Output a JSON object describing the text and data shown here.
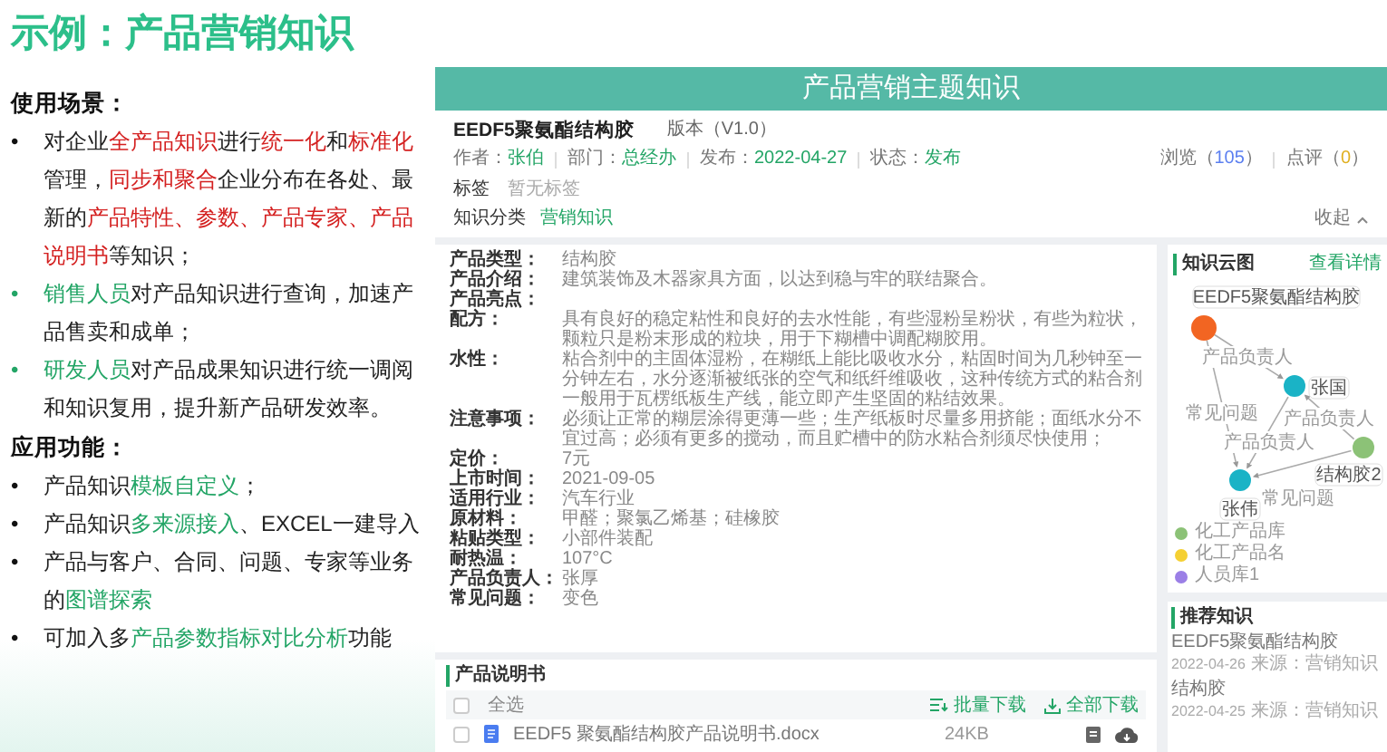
{
  "title": "示例：产品营销知识",
  "sections": [
    {
      "heading": "使用场景：",
      "items": [
        {
          "bullet": "•",
          "accent": false,
          "segments": [
            {
              "text": "对企业",
              "kind": "plain"
            },
            {
              "text": "全产品知识",
              "kind": "red"
            },
            {
              "text": "进行",
              "kind": "plain"
            },
            {
              "text": "统一化",
              "kind": "red"
            },
            {
              "text": "和",
              "kind": "plain"
            },
            {
              "text": "标准化",
              "kind": "red"
            },
            {
              "text": "管理，",
              "kind": "plain"
            },
            {
              "text": "同步和聚合",
              "kind": "red"
            },
            {
              "text": "企业分布在各处、最新的",
              "kind": "plain"
            },
            {
              "text": "产品特性、参数、产品专家、产品说明书",
              "kind": "red"
            },
            {
              "text": "等知识；",
              "kind": "plain"
            }
          ]
        },
        {
          "bullet": "•",
          "accent": true,
          "segments": [
            {
              "text": "销售人员",
              "kind": "green"
            },
            {
              "text": "对产品知识进行查询，加速产品售卖和成单；",
              "kind": "plain"
            }
          ]
        },
        {
          "bullet": "•",
          "accent": true,
          "segments": [
            {
              "text": "研发人员",
              "kind": "green"
            },
            {
              "text": "对产品成果知识进行统一调阅和知识复用，提升新产品研发效率。",
              "kind": "plain"
            }
          ]
        }
      ]
    },
    {
      "heading": "应用功能：",
      "items": [
        {
          "bullet": "•",
          "accent": false,
          "segments": [
            {
              "text": "产品知识",
              "kind": "plain"
            },
            {
              "text": "模板自定义",
              "kind": "green"
            },
            {
              "text": "；",
              "kind": "plain"
            }
          ]
        },
        {
          "bullet": "•",
          "accent": false,
          "segments": [
            {
              "text": "产品知识",
              "kind": "plain"
            },
            {
              "text": "多来源接入",
              "kind": "green"
            },
            {
              "text": "、EXCEL一建导入",
              "kind": "plain"
            }
          ]
        },
        {
          "bullet": "•",
          "accent": false,
          "segments": [
            {
              "text": "产品与客户、合同、问题、专家等业务的",
              "kind": "plain"
            },
            {
              "text": "图谱探索",
              "kind": "green"
            }
          ]
        },
        {
          "bullet": "•",
          "accent": false,
          "segments": [
            {
              "text": "可加入多",
              "kind": "plain"
            },
            {
              "text": "产品参数指标对比分析",
              "kind": "green"
            },
            {
              "text": "功能",
              "kind": "plain"
            }
          ]
        }
      ]
    }
  ],
  "app": {
    "header": "产品营销主题知识",
    "info": {
      "name": "EEDF5聚氨酯结构胶",
      "version": "版本（V1.0）",
      "meta": [
        {
          "label": "作者：",
          "value": "张伯"
        },
        {
          "label": "部门：",
          "value": "总经办"
        },
        {
          "label": "发布：",
          "value": "2022-04-27"
        },
        {
          "label": "状态：",
          "value": "发布"
        }
      ],
      "stats": [
        {
          "label": "浏览（",
          "value": "105",
          "end": "）",
          "kind": "views"
        },
        {
          "label": "点评（",
          "value": "0",
          "end": "）",
          "kind": "comments"
        }
      ],
      "tags_label": "标签",
      "tags_value": "暂无标签",
      "category_label": "知识分类",
      "category_value": "营销知识",
      "collapse": "收起"
    },
    "details": [
      {
        "label": "产品类型：",
        "value": "结构胶"
      },
      {
        "label": "产品介绍：",
        "value": "建筑装饰及木器家具方面，以达到稳与牢的联结聚合。"
      },
      {
        "label": "产品亮点："
      },
      {
        "label": "配方：",
        "value": "具有良好的稳定粘性和良好的去水性能，有些湿粉呈粉状，有些为粒状，颗粒只是粉末形成的粒块，用于下糊槽中调配糊胶用。"
      },
      {
        "label": "水性：",
        "value": "粘合剂中的主固体湿粉，在糊纸上能比吸收水分，粘固时间为几秒钟至一分钟左右，水分逐渐被纸张的空气和纸纤维吸收，这种传统方式的粘合剂一般用于瓦楞纸板生产线，能立即产生坚固的粘结效果。"
      },
      {
        "label": "注意事项：",
        "value": "必须让正常的糊层涂得更薄一些；生产纸板时尽量多用挤能；面纸水分不宜过高；必须有更多的搅动，而且贮槽中的防水粘合剂须尽快使用；"
      },
      {
        "label": "定价：",
        "value": "7元"
      },
      {
        "label": "上市时间：",
        "value": "2021-09-05"
      },
      {
        "label": "适用行业：",
        "value": "汽车行业"
      },
      {
        "label": "原材料：",
        "value": "甲醛；聚氯乙烯基；硅橡胶"
      },
      {
        "label": "粘贴类型：",
        "value": "小部件装配"
      },
      {
        "label": "耐热温：",
        "value": "107°C"
      },
      {
        "label": "产品负责人：",
        "value": "张厚"
      },
      {
        "label": "常见问题：",
        "value": "变色"
      }
    ],
    "graph": {
      "title": "知识云图",
      "link": "查看详情",
      "nodes": [
        {
          "label": "EEDF5聚氨酯结构胶",
          "color": "#f26522"
        },
        {
          "label": "张国",
          "color": "#1ab3c6"
        },
        {
          "label": "结构胶2",
          "color": "#8cc277"
        },
        {
          "label": "张伟",
          "color": "#1ab3c6"
        }
      ],
      "edges": [
        {
          "label": "产品负责人"
        },
        {
          "label": "常见问题"
        },
        {
          "label": "产品负责人"
        },
        {
          "label": "产品负责人"
        },
        {
          "label": "常见问题"
        }
      ],
      "legend": [
        {
          "label": "化工产品库",
          "color": "#8cc277"
        },
        {
          "label": "化工产品名",
          "color": "#f5d033"
        },
        {
          "label": "人员库1",
          "color": "#9b7fe6"
        }
      ]
    },
    "recommended": {
      "title": "推荐知识",
      "items": [
        {
          "name": "EEDF5聚氨酯结构胶",
          "date": "2022-04-26",
          "source": "来源：营销知识"
        },
        {
          "name": "结构胶",
          "date": "2022-04-25",
          "source": "来源：营销知识"
        }
      ]
    },
    "manual": {
      "title": "产品说明书",
      "select_all": {
        "label": "全选",
        "checked": false
      },
      "batch": "批量下载",
      "all": "全部下载",
      "files": [
        {
          "name": "EEDF5 聚氨酯结构胶产品说明书.docx",
          "size": "24KB",
          "checked": false
        }
      ]
    }
  }
}
